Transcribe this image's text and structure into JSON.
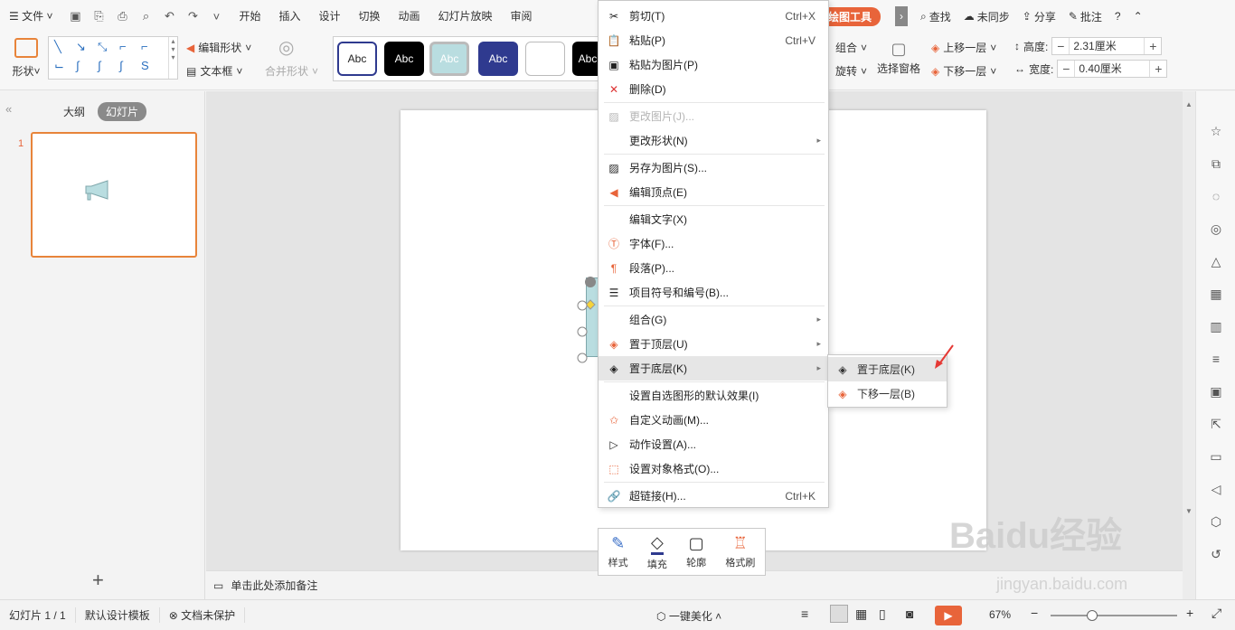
{
  "menubar": {
    "file": "文件",
    "tabs": [
      "开始",
      "插入",
      "设计",
      "切换",
      "动画",
      "幻灯片放映",
      "审阅"
    ],
    "drawing_tool": "绘图工具",
    "search": "查找",
    "sync": "未同步",
    "share": "分享",
    "comment": "批注",
    "help": "?"
  },
  "ribbon": {
    "shape": "形状",
    "edit_shape": "编辑形状",
    "text_box": "文本框",
    "merge_shape": "合并形状",
    "style_samples": [
      "Abc",
      "Abc",
      "Abc",
      "Abc",
      "",
      "Abc"
    ],
    "group": "组合",
    "rotate": "旋转",
    "selection_pane": "选择窗格",
    "bring_forward": "上移一层",
    "send_backward": "下移一层",
    "height_label": "高度:",
    "height_value": "2.31厘米",
    "width_label": "宽度:",
    "width_value": "0.40厘米"
  },
  "left_panel": {
    "tab_outline": "大纲",
    "tab_slides": "幻灯片",
    "slide_number": "1",
    "add": "+"
  },
  "notes": {
    "placeholder": "单击此处添加备注"
  },
  "context_menu": {
    "items": [
      {
        "label": "剪切(T)",
        "shortcut": "Ctrl+X"
      },
      {
        "label": "粘贴(P)",
        "shortcut": "Ctrl+V"
      },
      {
        "label": "粘贴为图片(P)",
        "shortcut": ""
      },
      {
        "label": "删除(D)",
        "shortcut": ""
      },
      {
        "label": "更改图片(J)...",
        "shortcut": ""
      },
      {
        "label": "更改形状(N)",
        "shortcut": ""
      },
      {
        "label": "另存为图片(S)...",
        "shortcut": ""
      },
      {
        "label": "编辑顶点(E)",
        "shortcut": ""
      },
      {
        "label": "编辑文字(X)",
        "shortcut": ""
      },
      {
        "label": "字体(F)...",
        "shortcut": ""
      },
      {
        "label": "段落(P)...",
        "shortcut": ""
      },
      {
        "label": "项目符号和编号(B)...",
        "shortcut": ""
      },
      {
        "label": "组合(G)",
        "shortcut": ""
      },
      {
        "label": "置于顶层(U)",
        "shortcut": ""
      },
      {
        "label": "置于底层(K)",
        "shortcut": ""
      },
      {
        "label": "设置自选图形的默认效果(I)",
        "shortcut": ""
      },
      {
        "label": "自定义动画(M)...",
        "shortcut": ""
      },
      {
        "label": "动作设置(A)...",
        "shortcut": ""
      },
      {
        "label": "设置对象格式(O)...",
        "shortcut": ""
      },
      {
        "label": "超链接(H)...",
        "shortcut": "Ctrl+K"
      }
    ]
  },
  "submenu": {
    "items": [
      {
        "label": "置于底层(K)"
      },
      {
        "label": "下移一层(B)"
      }
    ]
  },
  "mini_toolbar": {
    "style": "样式",
    "fill": "填充",
    "outline": "轮廓",
    "format_painter": "格式刷"
  },
  "statusbar": {
    "slide": "幻灯片 1 / 1",
    "template": "默认设计模板",
    "protect": "文档未保护",
    "beautify": "一键美化",
    "zoom": "67%"
  },
  "watermark": {
    "main": "Baidu经验",
    "sub": "jingyan.baidu.com"
  },
  "colors": {
    "accent": "#e8643a",
    "shape_fill": "#b9dde0"
  }
}
